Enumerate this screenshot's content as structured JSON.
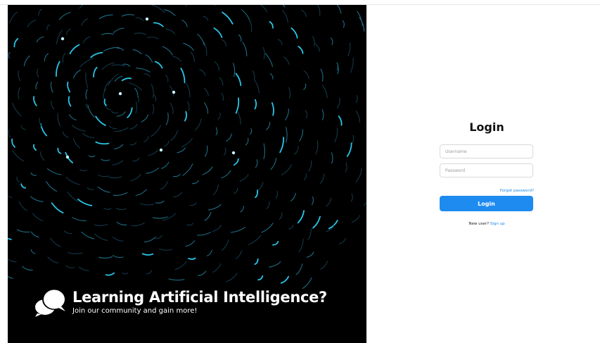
{
  "hero": {
    "title": "Learning Artificial Intelligence?",
    "subtitle": "Join our community and gain more!",
    "background_color": "#000000",
    "accent_color": "#29c6e8",
    "logo_icon": "chat-bubbles-icon"
  },
  "login": {
    "title": "Login",
    "username_placeholder": "Username",
    "password_placeholder": "Password",
    "forgot_password": "Forgot password?",
    "button_label": "Login",
    "signup_prompt": "New user?",
    "signup_link": "Sign up",
    "accent_color": "#1e8bf0"
  }
}
